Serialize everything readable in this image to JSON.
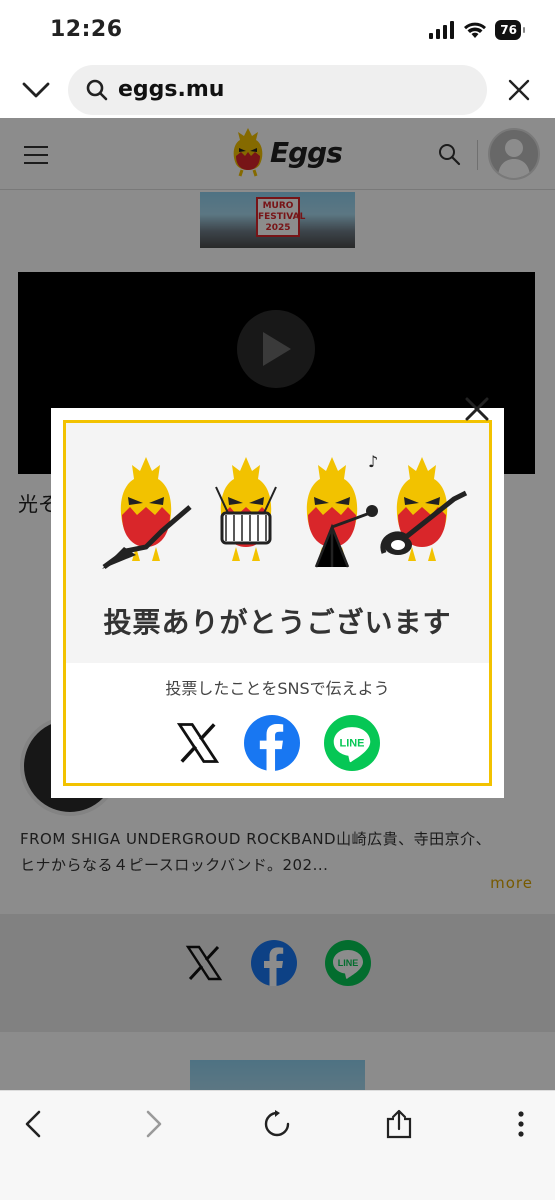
{
  "status_bar": {
    "time": "12:26",
    "battery": "76"
  },
  "browser": {
    "url": "eggs.mu"
  },
  "site": {
    "logo_text": "Eggs",
    "banner_text": "MURO FESTIVAL 2025",
    "title_peek": "光そ",
    "artist_description_line1": "FROM SHIGA UNDERGROUD ROCKBAND山崎広貴、寺田京介、",
    "artist_description_line2": "ヒナからなる４ピースロックバンド。202...",
    "more_label": "more"
  },
  "modal": {
    "thanks_text": "投票ありがとうございます",
    "share_prompt": "投票したことをSNSで伝えよう",
    "line_label": "LINE"
  },
  "colors": {
    "accent_yellow": "#f2c200",
    "facebook_blue": "#1877f2",
    "line_green": "#06c755",
    "egg_red": "#d9262a"
  },
  "icons": {
    "url_bar": [
      "chevron-down-icon",
      "search-icon",
      "close-icon"
    ],
    "toolbar": [
      "back-icon",
      "forward-icon",
      "reload-icon",
      "share-icon",
      "more-icon"
    ]
  }
}
